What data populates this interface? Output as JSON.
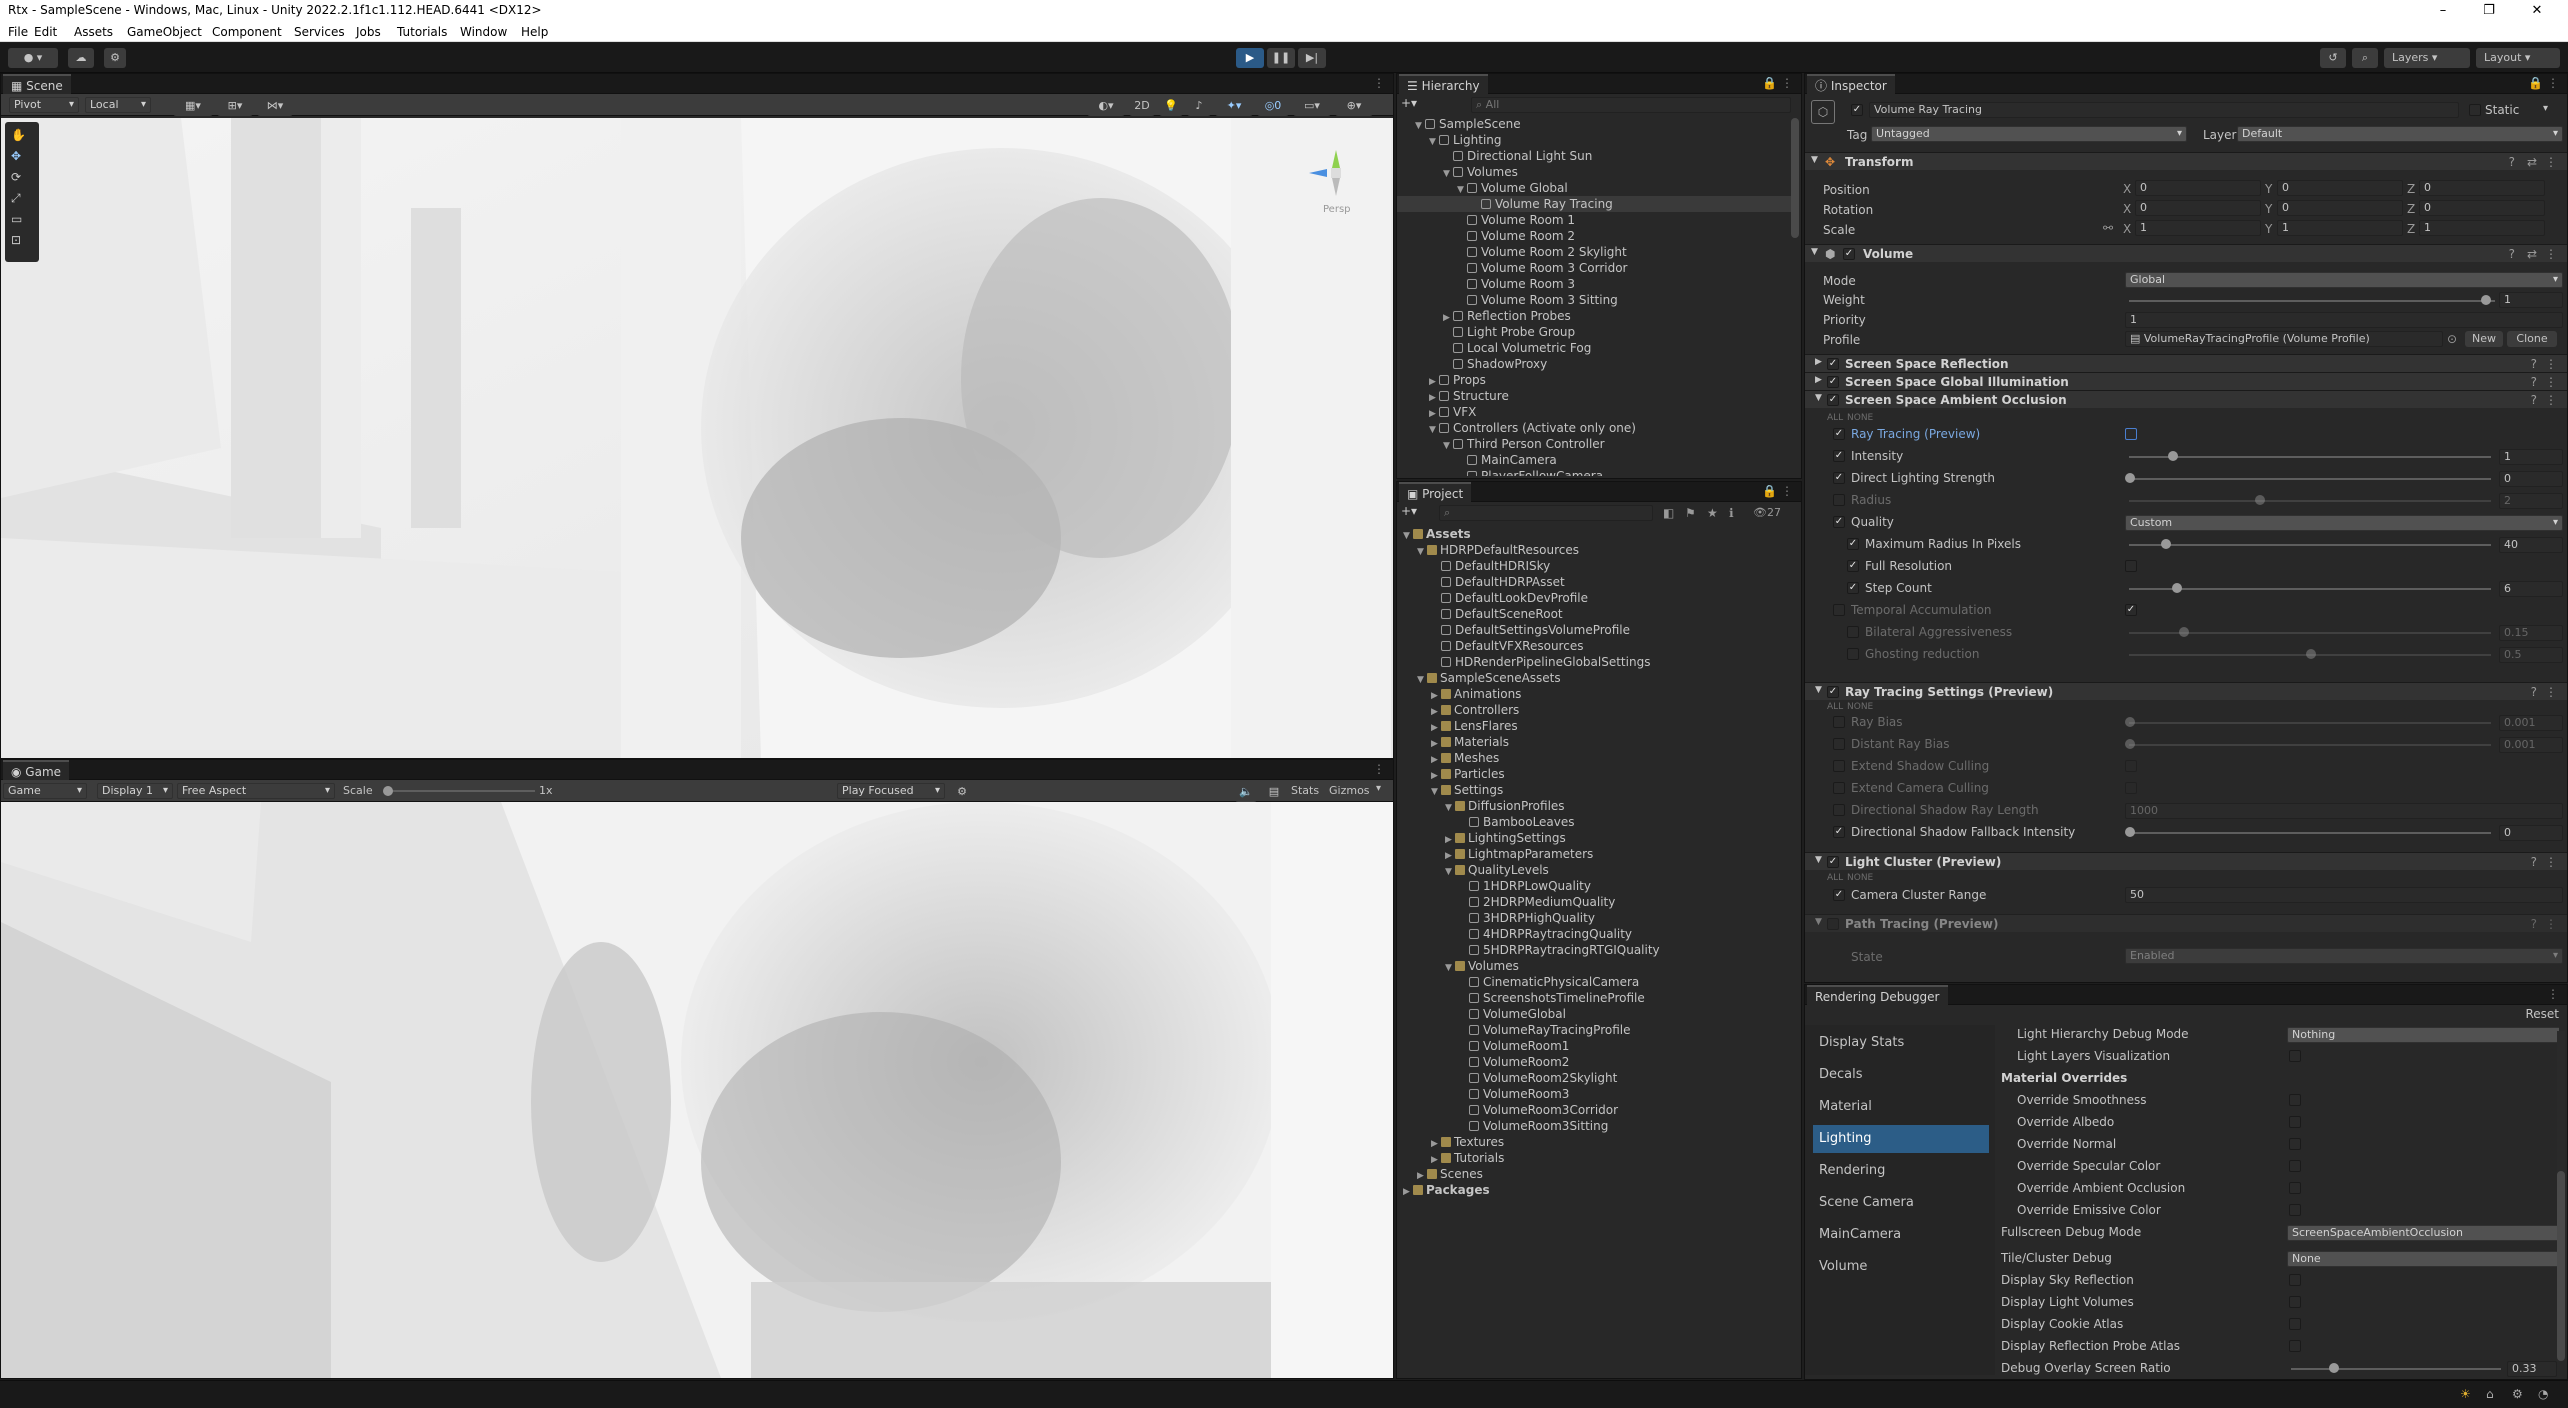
{
  "window": {
    "title": "Rtx - SampleScene - Windows, Mac, Linux - Unity 2022.2.1f1c1.112.HEAD.6441 <DX12>"
  },
  "menu": [
    "File",
    "Edit",
    "Assets",
    "GameObject",
    "Component",
    "Services",
    "Jobs",
    "Tutorials",
    "Window",
    "Help"
  ],
  "toolbar": {
    "layers": "Layers",
    "layout": "Layout"
  },
  "scene": {
    "tab": "Scene",
    "pivot": "Pivot",
    "local": "Local",
    "two_d": "2D",
    "persp": "Persp"
  },
  "game": {
    "tab": "Game",
    "mode": "Game",
    "display": "Display 1",
    "aspect": "Free Aspect",
    "scale_label": "Scale",
    "scale_value": "1x",
    "play_focused": "Play Focused",
    "stats": "Stats",
    "gizmos": "Gizmos"
  },
  "hierarchy": {
    "tab": "Hierarchy",
    "search": "All",
    "items": [
      {
        "label": "SampleScene",
        "d": 0,
        "o": 1,
        "s": 0,
        "f": 0
      },
      {
        "label": "Lighting",
        "d": 1,
        "o": 1,
        "s": 0,
        "f": 0
      },
      {
        "label": "Directional Light Sun",
        "d": 2,
        "o": 0,
        "s": 0,
        "f": 0
      },
      {
        "label": "Volumes",
        "d": 2,
        "o": 1,
        "s": 0,
        "f": 0
      },
      {
        "label": "Volume Global",
        "d": 3,
        "o": 1,
        "s": 0,
        "f": 0
      },
      {
        "label": "Volume Ray Tracing",
        "d": 4,
        "o": 0,
        "s": 1,
        "f": 0
      },
      {
        "label": "Volume Room 1",
        "d": 3,
        "o": 0,
        "s": 0,
        "f": 0
      },
      {
        "label": "Volume Room 2",
        "d": 3,
        "o": 0,
        "s": 0,
        "f": 0
      },
      {
        "label": "Volume Room 2 Skylight",
        "d": 3,
        "o": 0,
        "s": 0,
        "f": 0
      },
      {
        "label": "Volume Room 3 Corridor",
        "d": 3,
        "o": 0,
        "s": 0,
        "f": 0
      },
      {
        "label": "Volume Room 3",
        "d": 3,
        "o": 0,
        "s": 0,
        "f": 0
      },
      {
        "label": "Volume Room 3 Sitting",
        "d": 3,
        "o": 0,
        "s": 0,
        "f": 0
      },
      {
        "label": "Reflection Probes",
        "d": 2,
        "o": 2,
        "s": 0,
        "f": 0
      },
      {
        "label": "Light Probe Group",
        "d": 2,
        "o": 0,
        "s": 0,
        "f": 0
      },
      {
        "label": "Local Volumetric Fog",
        "d": 2,
        "o": 0,
        "s": 0,
        "f": 0
      },
      {
        "label": "ShadowProxy",
        "d": 2,
        "o": 0,
        "s": 0,
        "f": 0
      },
      {
        "label": "Props",
        "d": 1,
        "o": 2,
        "s": 0,
        "f": 0
      },
      {
        "label": "Structure",
        "d": 1,
        "o": 2,
        "s": 0,
        "f": 0
      },
      {
        "label": "VFX",
        "d": 1,
        "o": 2,
        "s": 0,
        "f": 0
      },
      {
        "label": "Controllers (Activate only one)",
        "d": 1,
        "o": 1,
        "s": 0,
        "f": 0
      },
      {
        "label": "Third Person Controller",
        "d": 2,
        "o": 1,
        "s": 0,
        "f": 0
      },
      {
        "label": "MainCamera",
        "d": 3,
        "o": 0,
        "s": 0,
        "f": 0
      },
      {
        "label": "PlayerFollowCamera",
        "d": 3,
        "o": 0,
        "s": 0,
        "f": 0
      }
    ]
  },
  "project": {
    "tab": "Project",
    "count": "27",
    "items": [
      {
        "label": "Assets",
        "d": 0,
        "o": 1,
        "f": 1,
        "b": 1
      },
      {
        "label": "HDRPDefaultResources",
        "d": 1,
        "o": 1,
        "f": 1,
        "b": 0
      },
      {
        "label": "DefaultHDRISky",
        "d": 2,
        "o": 0,
        "f": 0,
        "b": 0
      },
      {
        "label": "DefaultHDRPAsset",
        "d": 2,
        "o": 0,
        "f": 0,
        "b": 0
      },
      {
        "label": "DefaultLookDevProfile",
        "d": 2,
        "o": 0,
        "f": 0,
        "b": 0
      },
      {
        "label": "DefaultSceneRoot",
        "d": 2,
        "o": 0,
        "f": 0,
        "b": 0
      },
      {
        "label": "DefaultSettingsVolumeProfile",
        "d": 2,
        "o": 0,
        "f": 0,
        "b": 0
      },
      {
        "label": "DefaultVFXResources",
        "d": 2,
        "o": 0,
        "f": 0,
        "b": 0
      },
      {
        "label": "HDRenderPipelineGlobalSettings",
        "d": 2,
        "o": 0,
        "f": 0,
        "b": 0
      },
      {
        "label": "SampleSceneAssets",
        "d": 1,
        "o": 1,
        "f": 1,
        "b": 0
      },
      {
        "label": "Animations",
        "d": 2,
        "o": 2,
        "f": 1,
        "b": 0
      },
      {
        "label": "Controllers",
        "d": 2,
        "o": 2,
        "f": 1,
        "b": 0
      },
      {
        "label": "LensFlares",
        "d": 2,
        "o": 2,
        "f": 1,
        "b": 0
      },
      {
        "label": "Materials",
        "d": 2,
        "o": 2,
        "f": 1,
        "b": 0
      },
      {
        "label": "Meshes",
        "d": 2,
        "o": 2,
        "f": 1,
        "b": 0
      },
      {
        "label": "Particles",
        "d": 2,
        "o": 2,
        "f": 1,
        "b": 0
      },
      {
        "label": "Settings",
        "d": 2,
        "o": 1,
        "f": 1,
        "b": 0
      },
      {
        "label": "DiffusionProfiles",
        "d": 3,
        "o": 1,
        "f": 1,
        "b": 0
      },
      {
        "label": "BambooLeaves",
        "d": 4,
        "o": 0,
        "f": 0,
        "b": 0
      },
      {
        "label": "LightingSettings",
        "d": 3,
        "o": 2,
        "f": 1,
        "b": 0
      },
      {
        "label": "LightmapParameters",
        "d": 3,
        "o": 2,
        "f": 1,
        "b": 0
      },
      {
        "label": "QualityLevels",
        "d": 3,
        "o": 1,
        "f": 1,
        "b": 0
      },
      {
        "label": "1HDRPLowQuality",
        "d": 4,
        "o": 0,
        "f": 0,
        "b": 0
      },
      {
        "label": "2HDRPMediumQuality",
        "d": 4,
        "o": 0,
        "f": 0,
        "b": 0
      },
      {
        "label": "3HDRPHighQuality",
        "d": 4,
        "o": 0,
        "f": 0,
        "b": 0
      },
      {
        "label": "4HDRPRaytracingQuality",
        "d": 4,
        "o": 0,
        "f": 0,
        "b": 0
      },
      {
        "label": "5HDRPRaytracingRTGIQuality",
        "d": 4,
        "o": 0,
        "f": 0,
        "b": 0
      },
      {
        "label": "Volumes",
        "d": 3,
        "o": 1,
        "f": 1,
        "b": 0
      },
      {
        "label": "CinematicPhysicalCamera",
        "d": 4,
        "o": 0,
        "f": 0,
        "b": 0
      },
      {
        "label": "ScreenshotsTimelineProfile",
        "d": 4,
        "o": 0,
        "f": 0,
        "b": 0
      },
      {
        "label": "VolumeGlobal",
        "d": 4,
        "o": 0,
        "f": 0,
        "b": 0
      },
      {
        "label": "VolumeRayTracingProfile",
        "d": 4,
        "o": 0,
        "f": 0,
        "b": 0
      },
      {
        "label": "VolumeRoom1",
        "d": 4,
        "o": 0,
        "f": 0,
        "b": 0
      },
      {
        "label": "VolumeRoom2",
        "d": 4,
        "o": 0,
        "f": 0,
        "b": 0
      },
      {
        "label": "VolumeRoom2Skylight",
        "d": 4,
        "o": 0,
        "f": 0,
        "b": 0
      },
      {
        "label": "VolumeRoom3",
        "d": 4,
        "o": 0,
        "f": 0,
        "b": 0
      },
      {
        "label": "VolumeRoom3Corridor",
        "d": 4,
        "o": 0,
        "f": 0,
        "b": 0
      },
      {
        "label": "VolumeRoom3Sitting",
        "d": 4,
        "o": 0,
        "f": 0,
        "b": 0
      },
      {
        "label": "Textures",
        "d": 2,
        "o": 2,
        "f": 1,
        "b": 0
      },
      {
        "label": "Tutorials",
        "d": 2,
        "o": 2,
        "f": 1,
        "b": 0
      },
      {
        "label": "Scenes",
        "d": 1,
        "o": 2,
        "f": 1,
        "b": 0
      },
      {
        "label": "Packages",
        "d": 0,
        "o": 2,
        "f": 1,
        "b": 1
      }
    ]
  },
  "inspector": {
    "tab": "Inspector",
    "object_name": "Volume Ray Tracing",
    "static": "Static",
    "tag_label": "Tag",
    "tag_value": "Untagged",
    "layer_label": "Layer",
    "layer_value": "Default",
    "transform": {
      "title": "Transform",
      "position": "Position",
      "rotation": "Rotation",
      "scale": "Scale",
      "pos": [
        "0",
        "0",
        "0"
      ],
      "rot": [
        "0",
        "0",
        "0"
      ],
      "scl": [
        "1",
        "1",
        "1"
      ]
    },
    "volume": {
      "title": "Volume",
      "mode_label": "Mode",
      "mode": "Global",
      "weight_label": "Weight",
      "weight": "1",
      "priority_label": "Priority",
      "priority": "1",
      "profile_label": "Profile",
      "profile": "VolumeRayTracingProfile (Volume Profile)",
      "new": "New",
      "clone": "Clone"
    },
    "overrides": [
      "Screen Space Reflection",
      "Screen Space Global Illumination",
      "Screen Space Ambient Occlusion"
    ],
    "all": "ALL",
    "none": "NONE",
    "ssao": {
      "ray_tracing": "Ray Tracing (Preview)",
      "intensity": "Intensity",
      "intensity_v": "1",
      "dls": "Direct Lighting Strength",
      "dls_v": "0",
      "radius": "Radius",
      "radius_v": "2",
      "quality": "Quality",
      "quality_v": "Custom",
      "maxr": "Maximum Radius In Pixels",
      "maxr_v": "40",
      "fullres": "Full Resolution",
      "step": "Step Count",
      "step_v": "6",
      "temporal": "Temporal Accumulation",
      "bilateral": "Bilateral Aggressiveness",
      "bilateral_v": "0.15",
      "ghost": "Ghosting reduction",
      "ghost_v": "0.5"
    },
    "rts": {
      "title": "Ray Tracing Settings (Preview)",
      "raybias": "Ray Bias",
      "raybias_v": "0.001",
      "distbias": "Distant Ray Bias",
      "distbias_v": "0.001",
      "extshadow": "Extend Shadow Culling",
      "extcam": "Extend Camera Culling",
      "dirlen": "Directional Shadow Ray Length",
      "dirlen_v": "1000",
      "dirfb": "Directional Shadow Fallback Intensity",
      "dirfb_v": "0"
    },
    "lc": {
      "title": "Light Cluster (Preview)",
      "range": "Camera Cluster Range",
      "range_v": "50"
    },
    "pt": {
      "title": "Path Tracing (Preview)",
      "state": "State",
      "state_v": "Enabled"
    }
  },
  "debugger": {
    "tab": "Rendering Debugger",
    "reset": "Reset",
    "nav": [
      "Display Stats",
      "Decals",
      "Material",
      "Lighting",
      "Rendering",
      "Scene Camera",
      "MainCamera",
      "Volume"
    ],
    "active": "Lighting",
    "rows": {
      "lhdm": "Light Hierarchy Debug Mode",
      "lhdm_v": "Nothing",
      "llv": "Light Layers Visualization",
      "mo": "Material Overrides",
      "os": "Override Smoothness",
      "oa": "Override Albedo",
      "on": "Override Normal",
      "osc": "Override Specular Color",
      "oao": "Override Ambient Occlusion",
      "oec": "Override Emissive Color",
      "fdm": "Fullscreen Debug Mode",
      "fdm_v": "ScreenSpaceAmbientOcclusion",
      "tcd": "Tile/Cluster Debug",
      "tcd_v": "None",
      "dsr": "Display Sky Reflection",
      "dlv": "Display Light Volumes",
      "dca": "Display Cookie Atlas",
      "drpa": "Display Reflection Probe Atlas",
      "dosr": "Debug Overlay Screen Ratio",
      "dosr_v": "0.33"
    }
  }
}
